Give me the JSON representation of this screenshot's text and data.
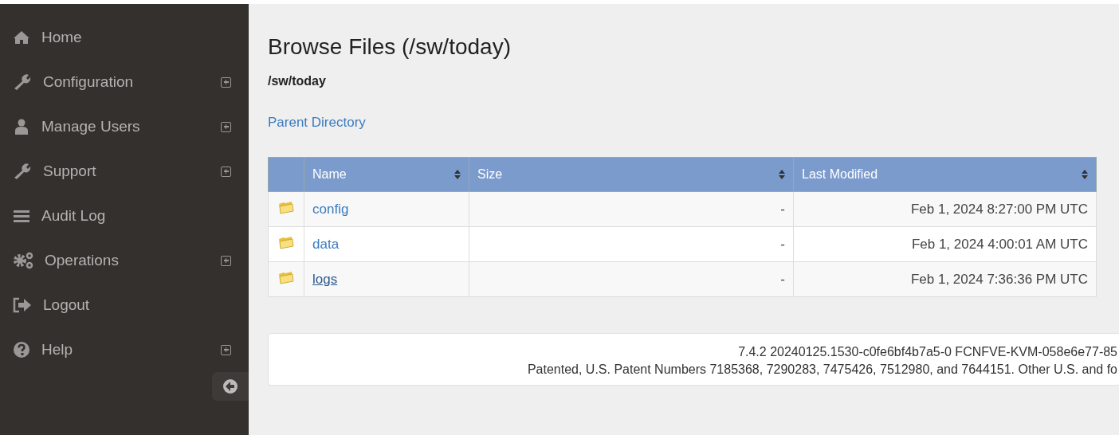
{
  "sidebar": {
    "items": [
      {
        "kind": "home",
        "label": "Home",
        "expandable": false
      },
      {
        "kind": "wrench",
        "label": "Configuration",
        "expandable": true
      },
      {
        "kind": "user",
        "label": "Manage Users",
        "expandable": true
      },
      {
        "kind": "wrench",
        "label": "Support",
        "expandable": true
      },
      {
        "kind": "list",
        "label": "Audit Log",
        "expandable": false
      },
      {
        "kind": "gears",
        "label": "Operations",
        "expandable": true
      },
      {
        "kind": "logout",
        "label": "Logout",
        "expandable": false
      },
      {
        "kind": "help",
        "label": "Help",
        "expandable": true
      }
    ]
  },
  "page": {
    "title": "Browse Files (/sw/today)",
    "path": "/sw/today",
    "parent_link": "Parent Directory"
  },
  "table": {
    "columns": [
      "Name",
      "Size",
      "Last Modified"
    ],
    "rows": [
      {
        "name": "config",
        "size": "-",
        "modified": "Feb 1, 2024 8:27:00 PM UTC",
        "hovered": false
      },
      {
        "name": "data",
        "size": "-",
        "modified": "Feb 1, 2024 4:00:01 AM UTC",
        "hovered": false
      },
      {
        "name": "logs",
        "size": "-",
        "modified": "Feb 1, 2024 7:36:36 PM UTC",
        "hovered": true
      }
    ]
  },
  "footer": {
    "version": "7.4.2 20240125.1530-c0fe6bf4b7a5-0 FCNFVE-KVM-058e6e77-85",
    "patents": "Patented, U.S. Patent Numbers 7185368, 7290283, 7475426, 7512980, and 7644151. Other U.S. and fo"
  }
}
